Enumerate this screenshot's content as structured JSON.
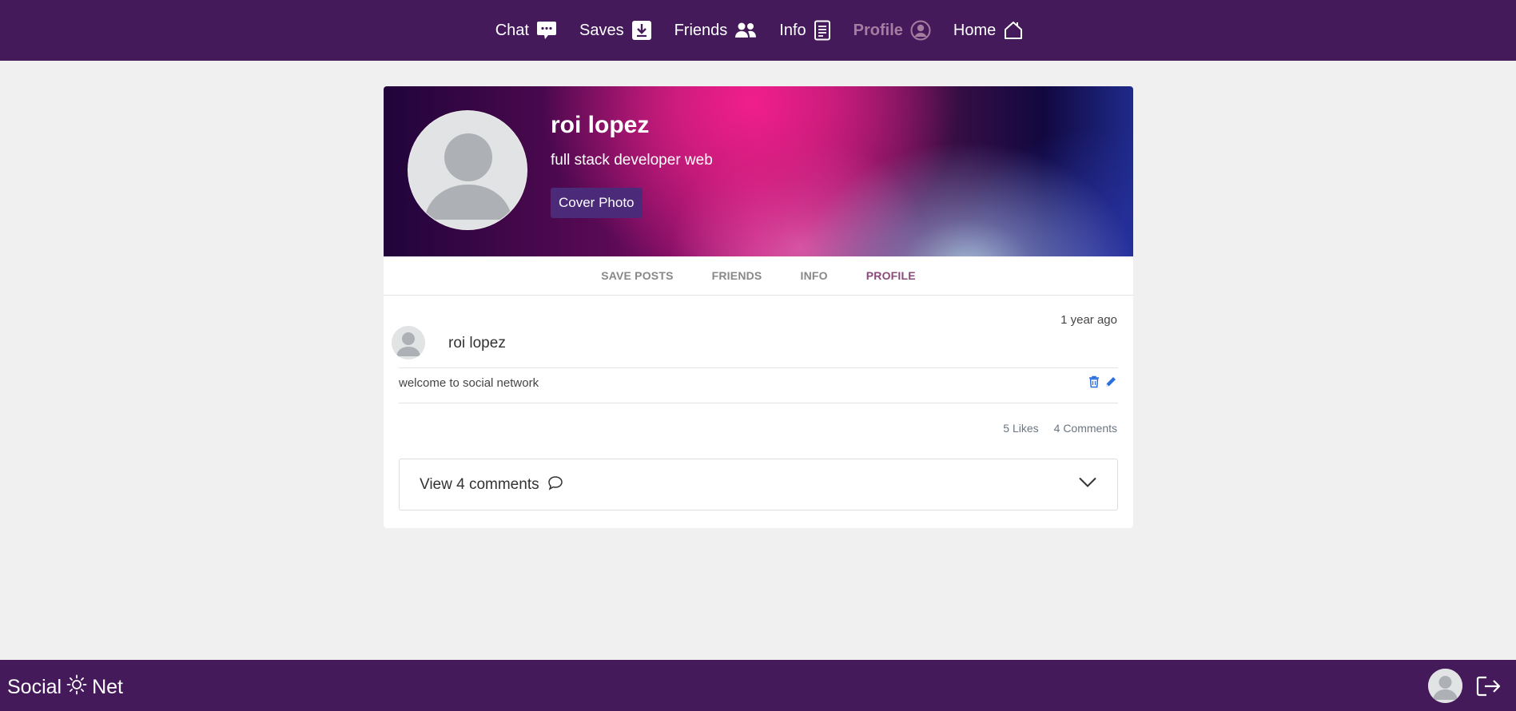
{
  "nav": {
    "items": [
      {
        "label": "Chat",
        "icon": "chat-icon"
      },
      {
        "label": "Saves",
        "icon": "download-icon"
      },
      {
        "label": "Friends",
        "icon": "friends-icon"
      },
      {
        "label": "Info",
        "icon": "document-icon"
      },
      {
        "label": "Profile",
        "icon": "user-circle-icon",
        "active": true
      },
      {
        "label": "Home",
        "icon": "home-icon"
      }
    ]
  },
  "profile": {
    "name": "roi lopez",
    "bio": "full stack developer web",
    "cover_button": "Cover Photo"
  },
  "tabs": [
    {
      "label": "SAVE POSTS"
    },
    {
      "label": "FRIENDS"
    },
    {
      "label": "INFO"
    },
    {
      "label": "PROFILE",
      "active": true
    }
  ],
  "post": {
    "time": "1 year ago",
    "author": "roi lopez",
    "text": "welcome to social network",
    "likes": "5 Likes",
    "comments": "4 Comments",
    "view_comments": "View 4 comments"
  },
  "footer": {
    "brand_left": "Social",
    "brand_right": "Net"
  },
  "colors": {
    "nav_bg": "#441a5b",
    "active_nav": "#a57da0",
    "active_tab": "#8a4a7a",
    "icon_blue": "#2a6fdb",
    "cover_button_bg": "#4b2a7a"
  }
}
